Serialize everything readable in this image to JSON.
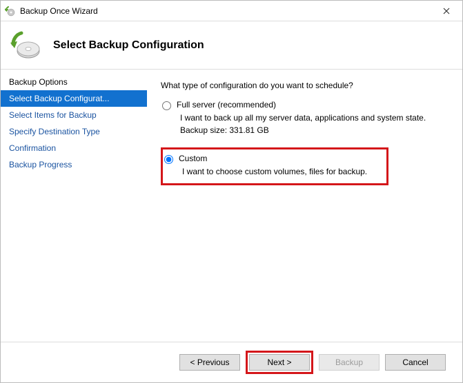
{
  "window": {
    "title": "Backup Once Wizard"
  },
  "header": {
    "heading": "Select Backup Configuration"
  },
  "sidebar": {
    "items": [
      {
        "label": "Backup Options",
        "state": "past"
      },
      {
        "label": "Select Backup Configurat...",
        "state": "current"
      },
      {
        "label": "Select Items for Backup",
        "state": "future"
      },
      {
        "label": "Specify Destination Type",
        "state": "future"
      },
      {
        "label": "Confirmation",
        "state": "future"
      },
      {
        "label": "Backup Progress",
        "state": "future"
      }
    ]
  },
  "content": {
    "prompt": "What type of configuration do you want to schedule?",
    "full": {
      "label": "Full server (recommended)",
      "desc": "I want to back up all my server data, applications and system state.",
      "size_line": "Backup size: 331.81 GB"
    },
    "custom": {
      "label": "Custom",
      "desc": "I want to choose custom volumes, files for backup."
    },
    "selected": "custom"
  },
  "footer": {
    "previous": "< Previous",
    "next": "Next >",
    "backup": "Backup",
    "cancel": "Cancel"
  }
}
